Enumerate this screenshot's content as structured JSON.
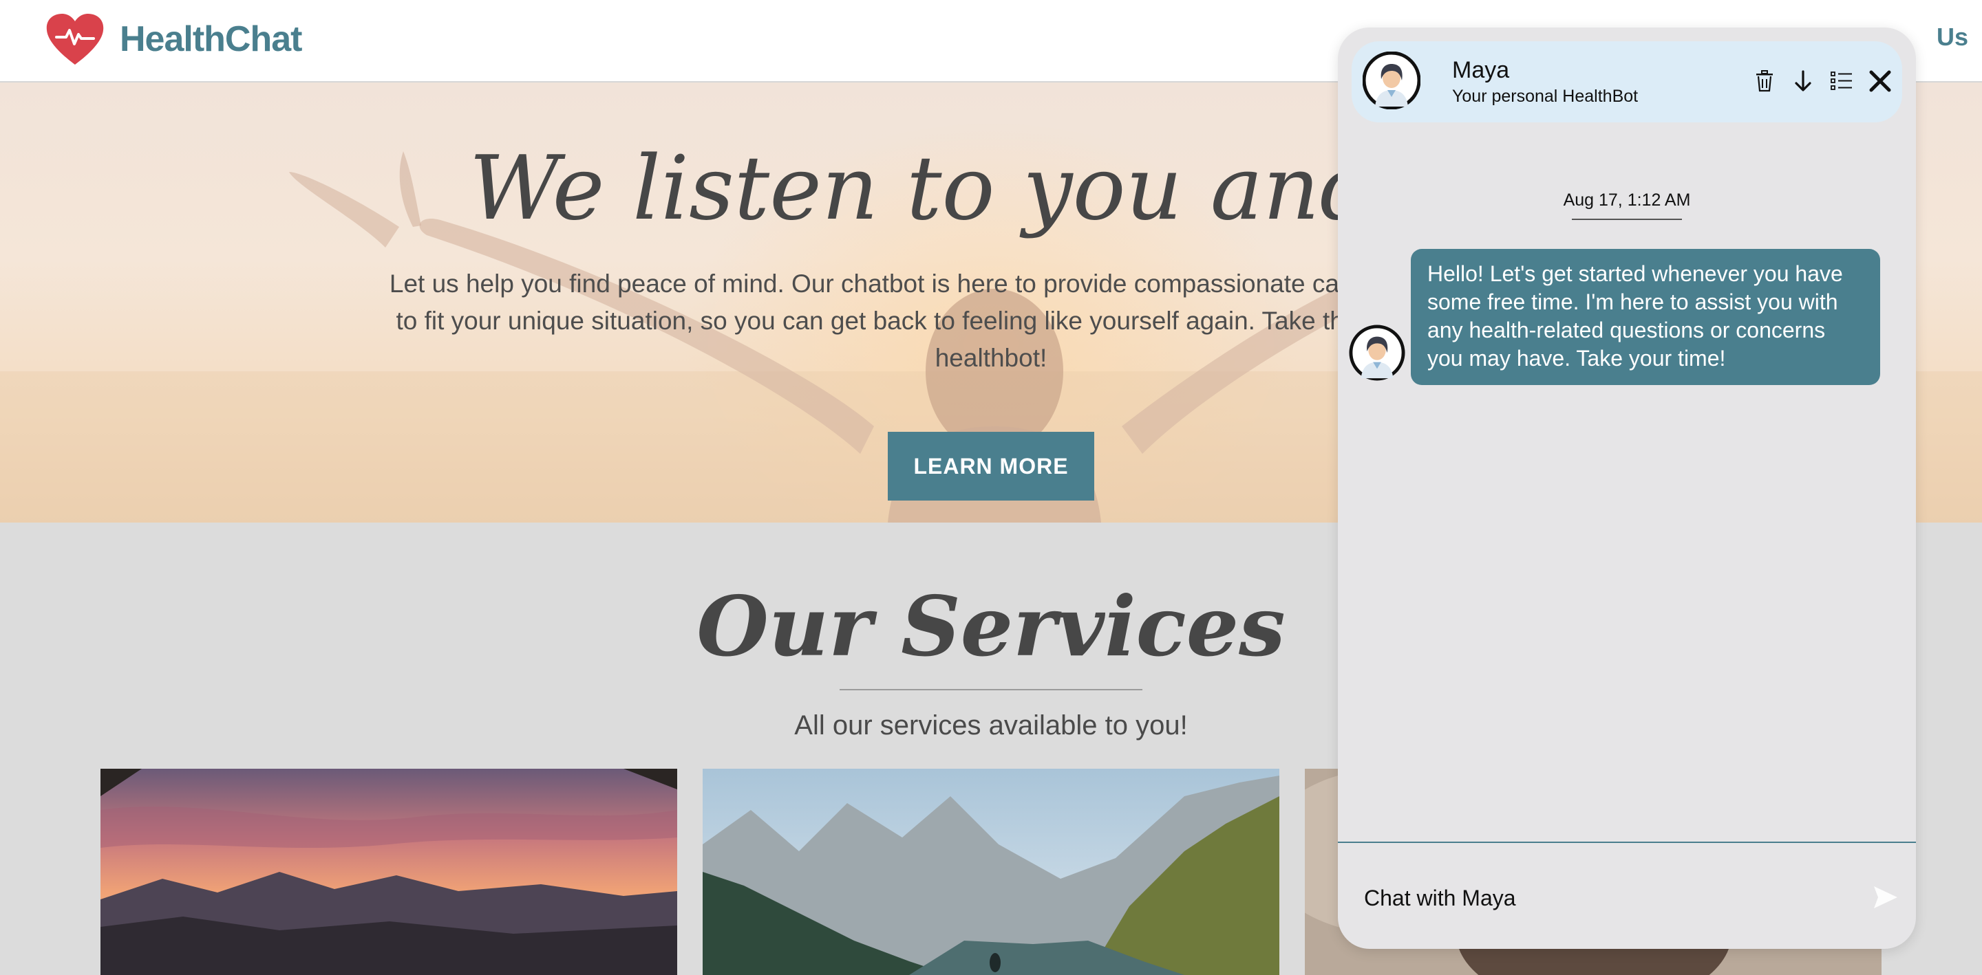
{
  "brand": {
    "name": "HealthChat",
    "color": "#4a7f8e",
    "logo_color": "#d9424b"
  },
  "nav": {
    "contact_partial": "Us"
  },
  "hero": {
    "title": "We listen to you and he",
    "text": "Let us help you find peace of mind. Our chatbot is here to provide compassionate care for all your mental h… to fit your unique situation, so you can get back to feeling like yourself again. Take the first step and conve… healthbot!",
    "text_lines": [
      "Let us help you find peace of mind. Our chatbot is here to provide compassionate care for all your mental h",
      "to fit your unique situation, so you can get back to feeling like yourself again. Take the first step and conve",
      "healthbot!"
    ],
    "button_label": "LEARN MORE"
  },
  "services": {
    "title": "Our Services",
    "subtitle": "All our services available to you!"
  },
  "chat": {
    "bot_name": "Maya",
    "bot_subtitle": "Your personal HealthBot",
    "date": "Aug 17, 1:12 AM",
    "message": "Hello! Let's get started whenever you have some free time. I'm here to assist you with any health-related questions or concerns you may have. Take your time!",
    "input_placeholder": "Chat with Maya",
    "icons": {
      "delete": "trash-icon",
      "scroll_down": "arrow-down-icon",
      "menu": "list-icon",
      "close": "close-icon",
      "send": "send-icon"
    }
  }
}
